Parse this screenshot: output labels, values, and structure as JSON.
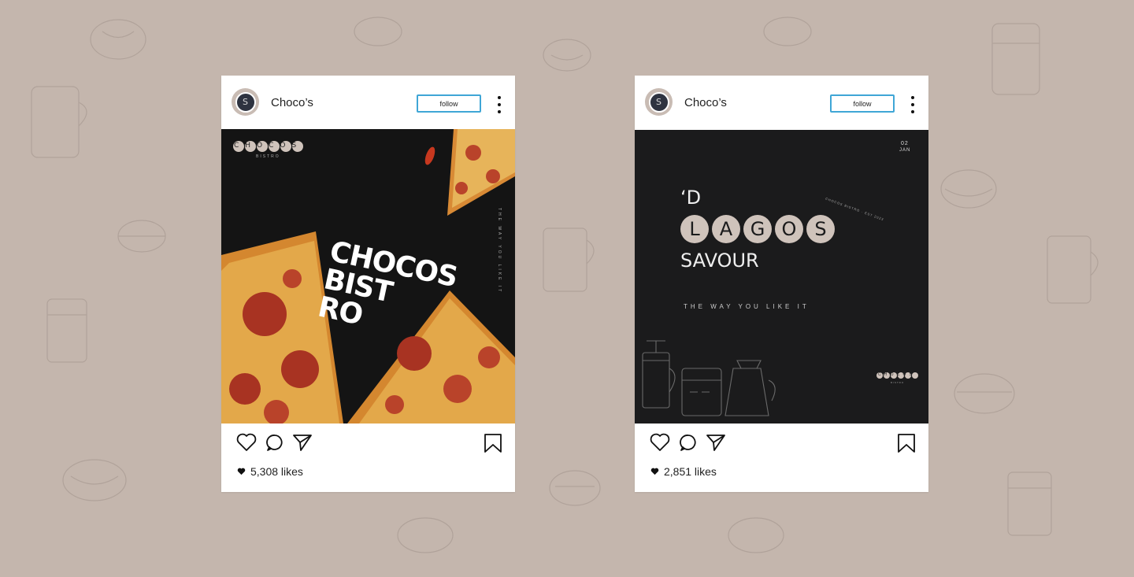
{
  "posts": [
    {
      "username": "Choco’s",
      "avatar_letter": "S",
      "follow_label": "follow",
      "likes": "5,308 likes",
      "image": {
        "brand": "CHOCOS",
        "brand_sub": "BISTRO",
        "headline_lines": [
          "CHOCOS",
          "BIST",
          "RO"
        ],
        "side_text": "THE WAY YOU LIKE IT",
        "background": "#141414"
      }
    },
    {
      "username": "Choco’s",
      "avatar_letter": "S",
      "follow_label": "follow",
      "likes": "2,851 likes",
      "image": {
        "date_day": "02",
        "date_month": "JAN",
        "prefix": "‘D",
        "word_letters": [
          "L",
          "A",
          "G",
          "O",
          "S"
        ],
        "suffix": "SAVOUR",
        "tagline": "THE WAY YOU LIKE IT",
        "badge_text": "CHOCOS BISTRO · EST 2023",
        "footer_brand": "CHOCOS",
        "footer_brand_sub": "BISTRO",
        "background": "#1b1b1c"
      }
    }
  ],
  "icons": [
    "heart-icon",
    "comment-icon",
    "share-icon",
    "bookmark-icon",
    "more-icon"
  ],
  "colors": {
    "page_background": "#c4b6ad",
    "follow_border": "#3fa6d6",
    "dark_panel": "#1b1b1c",
    "circle_fill": "#cfc3bb"
  }
}
